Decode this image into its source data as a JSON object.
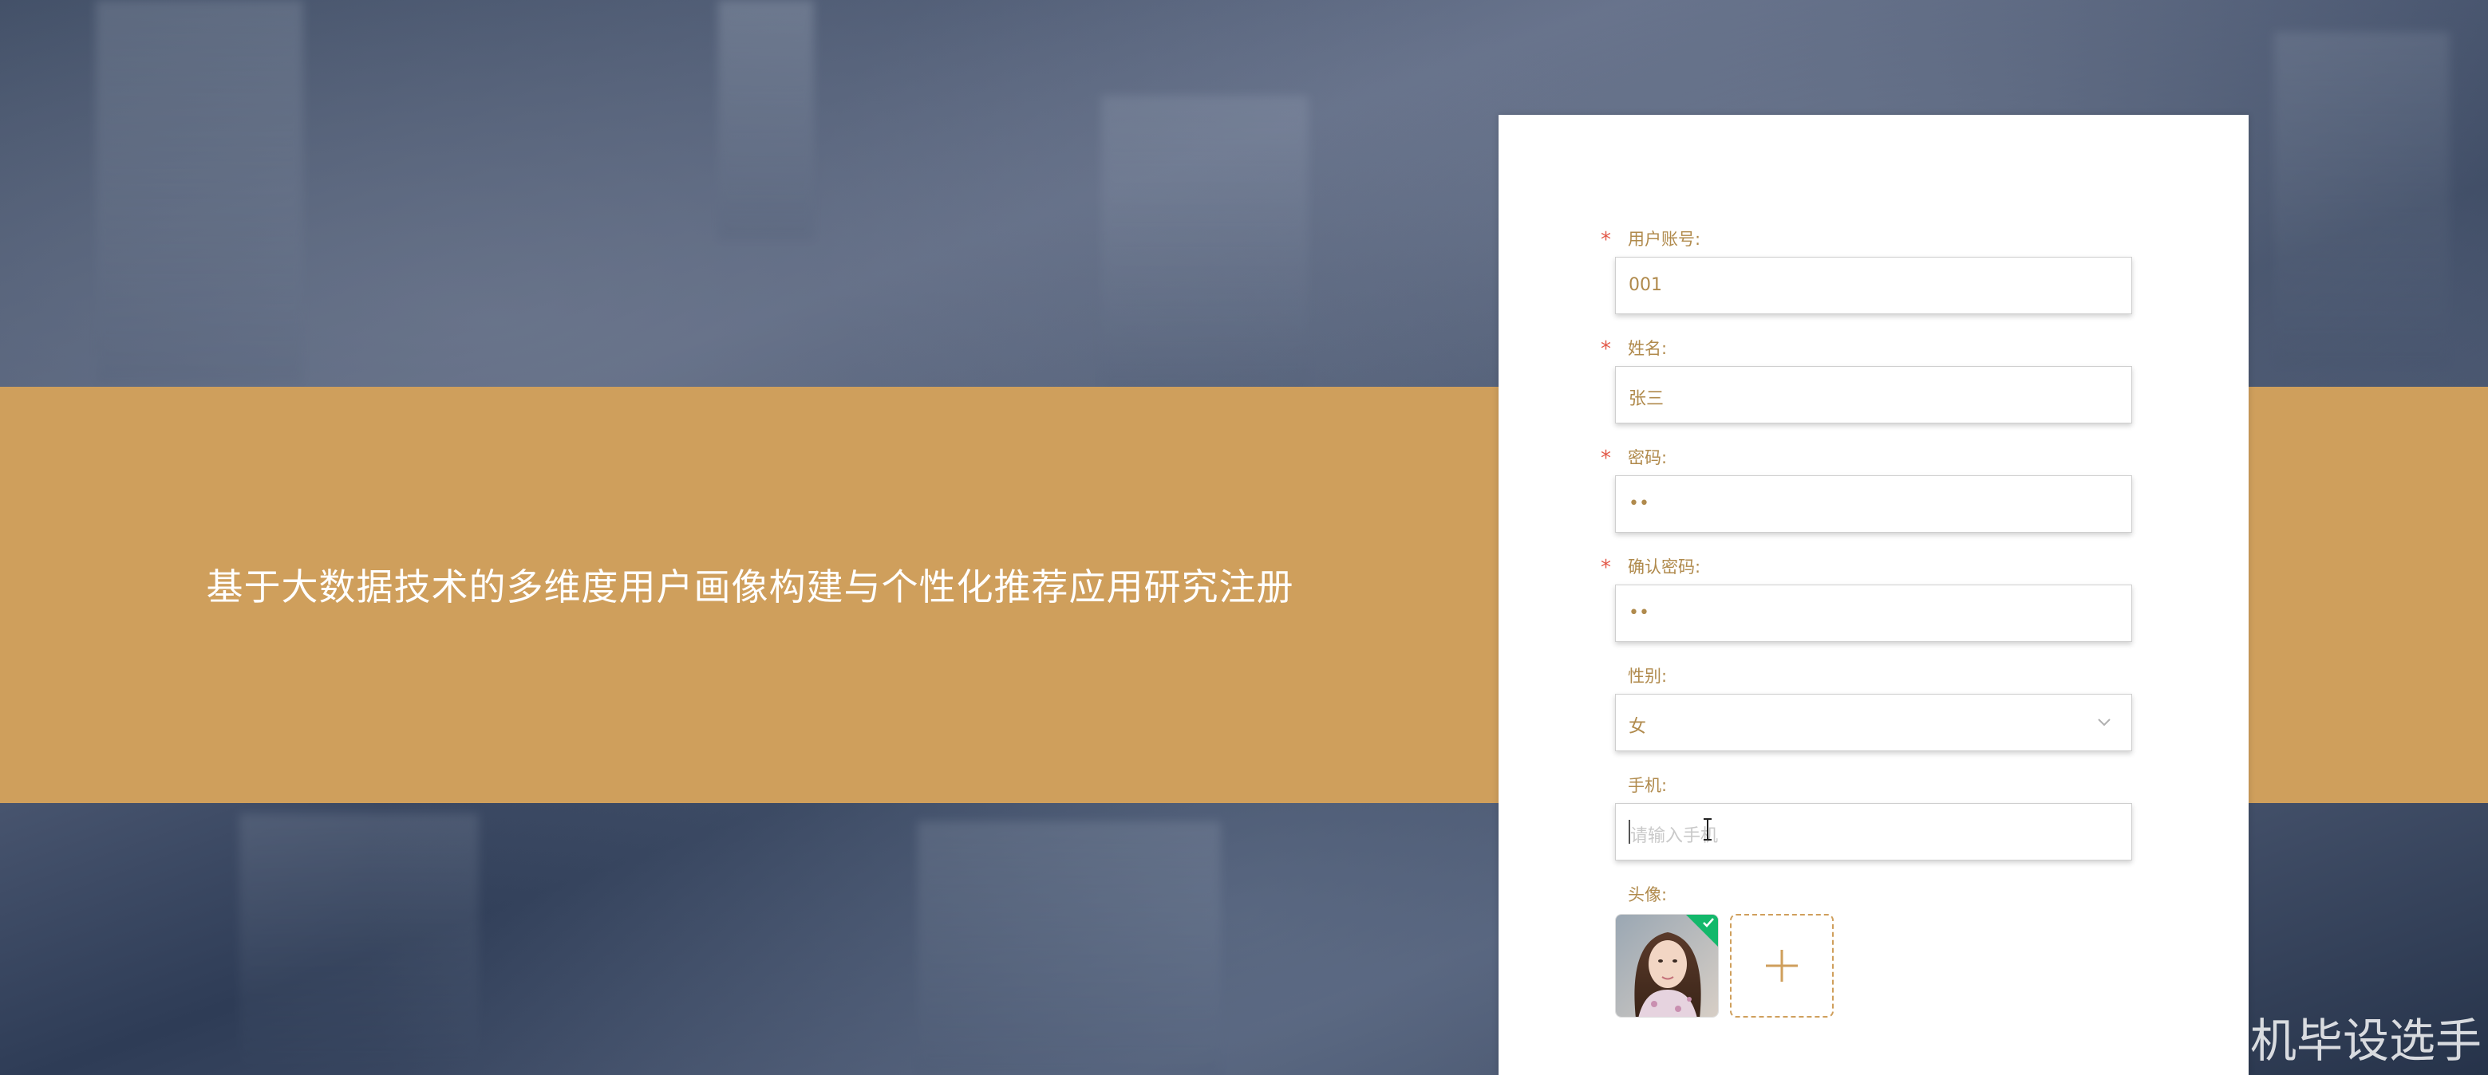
{
  "page": {
    "title": "基于大数据技术的多维度用户画像构建与个性化推荐应用研究注册"
  },
  "form": {
    "account": {
      "label": "用户账号:",
      "value": "001",
      "required": true
    },
    "name": {
      "label": "姓名:",
      "value": "张三",
      "required": true
    },
    "password": {
      "label": "密码:",
      "value": "••",
      "required": true
    },
    "confirm_password": {
      "label": "确认密码:",
      "value": "••",
      "required": true
    },
    "gender": {
      "label": "性别:",
      "value": "女",
      "icon": "chevron-down-icon"
    },
    "phone": {
      "label": "手机:",
      "value": "",
      "placeholder": "请输入手机"
    },
    "avatar": {
      "label": "头像:",
      "uploaded_icon": "check-icon",
      "add_icon": "plus-icon"
    }
  },
  "watermark": "CSDN @计算机毕设选手",
  "colors": {
    "accent": "#cf9f5c",
    "label": "#b08a4c",
    "required": "#e25a4a",
    "success": "#13b86b"
  }
}
